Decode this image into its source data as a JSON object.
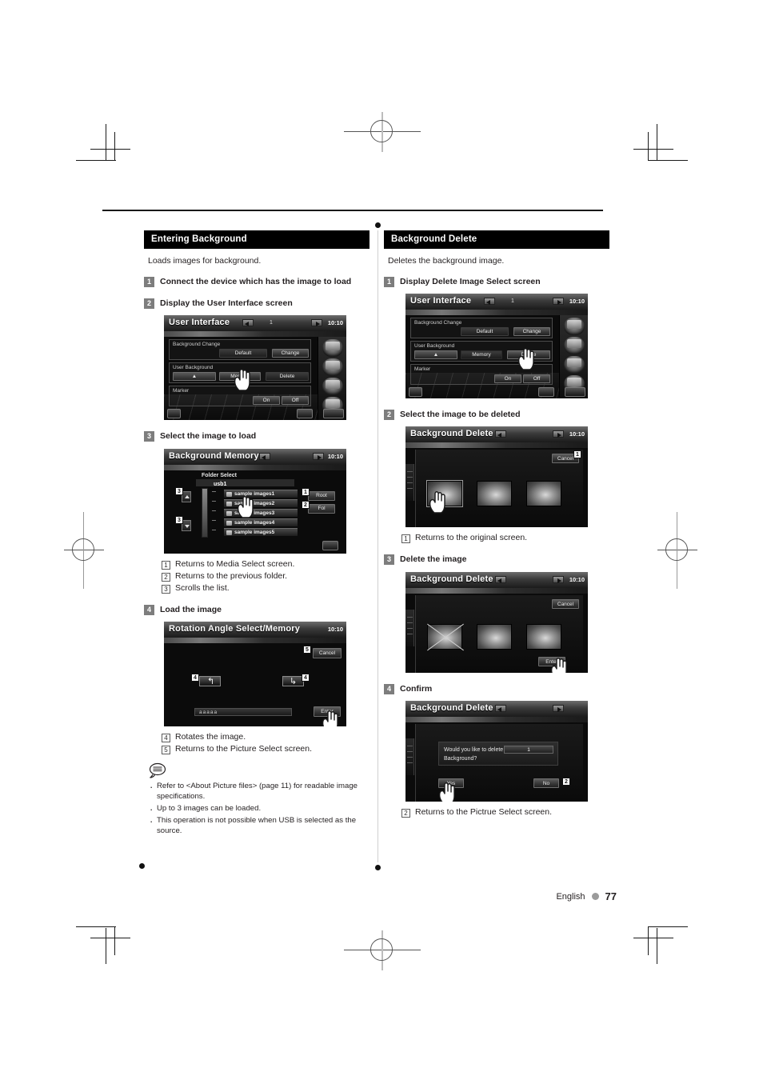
{
  "footer": {
    "language": "English",
    "page_number": "77"
  },
  "left_column": {
    "section_title": "Entering Background",
    "intro": "Loads images for background.",
    "steps": [
      {
        "num": "1",
        "text": "Connect the device which has the image to load"
      },
      {
        "num": "2",
        "text": "Display the User Interface screen"
      },
      {
        "num": "3",
        "text": "Select the image to load"
      },
      {
        "num": "4",
        "text": "Load the image"
      }
    ],
    "refs_after_step3": [
      {
        "num": "1",
        "text": "Returns to Media Select screen."
      },
      {
        "num": "2",
        "text": "Returns to the previous folder."
      },
      {
        "num": "3",
        "text": "Scrolls the list."
      }
    ],
    "refs_after_step4": [
      {
        "num": "4",
        "text": "Rotates the image."
      },
      {
        "num": "5",
        "text": "Returns to the Picture Select screen."
      }
    ],
    "note_icon": "note-balloon-icon",
    "notes": [
      "Refer to <About Picture files> (page 11) for readable image specifications.",
      "Up to 3 images can be loaded.",
      "This operation is not possible when USB is selected as the source."
    ]
  },
  "right_column": {
    "section_title": "Background Delete",
    "intro": "Deletes the background image.",
    "steps": [
      {
        "num": "1",
        "text": "Display Delete Image Select screen"
      },
      {
        "num": "2",
        "text": "Select the image to be deleted"
      },
      {
        "num": "3",
        "text": "Delete the image"
      },
      {
        "num": "4",
        "text": "Confirm"
      }
    ],
    "refs_after_step2": [
      {
        "num": "1",
        "text": "Returns to the original screen."
      }
    ],
    "refs_after_step4": [
      {
        "num": "2",
        "text": "Returns to the Pictrue Select screen."
      }
    ]
  },
  "screens": {
    "user_interface_memory": {
      "title": "User Interface",
      "clock": "10:10",
      "page_indicator": "1",
      "group1_label": "Background Change",
      "group1_buttons": [
        "Default",
        "Change"
      ],
      "group2_label": "User Background",
      "group2_buttons": [
        "Memory",
        "Delete"
      ],
      "group3_label": "Marker",
      "group3_buttons": [
        "On",
        "Off"
      ],
      "highlight_button": "Memory"
    },
    "user_interface_delete": {
      "title": "User Interface",
      "clock": "10:10",
      "page_indicator": "1",
      "group1_label": "Background Change",
      "group1_buttons": [
        "Default",
        "Change"
      ],
      "group2_label": "User Background",
      "group2_buttons": [
        "Memory",
        "Delete"
      ],
      "group3_label": "Marker",
      "group3_buttons": [
        "On",
        "Off"
      ],
      "highlight_button": "Delete"
    },
    "background_memory": {
      "title": "Background Memory",
      "clock": "10:10",
      "folder_select_label": "Folder Select",
      "path": "usb1",
      "files": [
        "sample images1",
        "sample images2",
        "sample images3",
        "sample images4",
        "sample images5"
      ],
      "side_buttons": [
        {
          "num": "1",
          "label": "Root"
        },
        {
          "num": "2",
          "label": "Fol"
        }
      ],
      "scroll_badges": [
        "3",
        "3"
      ]
    },
    "rotation": {
      "title": "Rotation Angle Select/Memory",
      "clock": "10:10",
      "cancel_label": "Cancel",
      "cancel_badge": "5",
      "enter_label": "Enter",
      "left_badge": "4",
      "right_badge": "4",
      "filename": "aaaaa"
    },
    "background_delete_select": {
      "title": "Background Delete",
      "clock": "10:10",
      "cancel_label": "Cancel",
      "cancel_badge": "1",
      "thumbnail_count": "3"
    },
    "background_delete_marked": {
      "title": "Background Delete",
      "clock": "10:10",
      "cancel_label": "Cancel",
      "enter_label": "Enter",
      "thumbnail_count": "3"
    },
    "background_delete_confirm": {
      "title": "Background Delete",
      "message_line1": "Would you like to delete",
      "message_line2": "Background?",
      "field_value": "1",
      "yes_label": "Yes",
      "no_label": "No",
      "no_badge": "2"
    }
  },
  "colors": {
    "section_header_bg": "#000000",
    "step_num_bg": "#7d7d7d",
    "text": "#231f20",
    "footer_dot": "#9b9b9b"
  }
}
